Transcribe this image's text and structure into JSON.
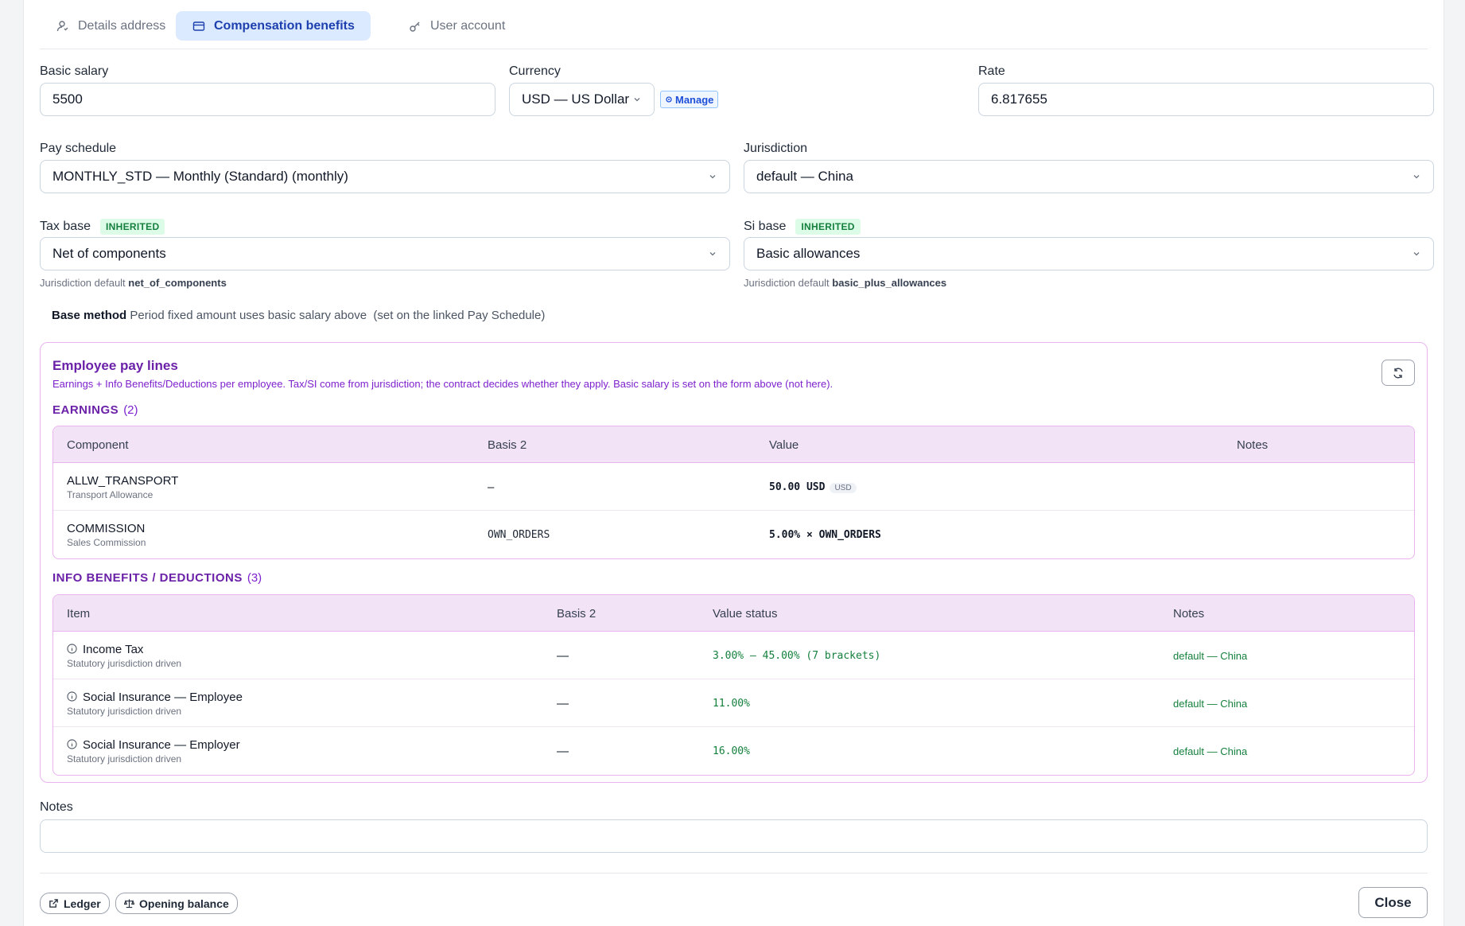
{
  "tabs": [
    {
      "label": "Details address",
      "icon": "user-icon"
    },
    {
      "label": "Compensation benefits",
      "icon": "card-icon"
    },
    {
      "label": "User account",
      "icon": "key-icon"
    }
  ],
  "form": {
    "basic_salary_label": "Basic salary",
    "basic_salary_value": "5500",
    "currency_label": "Currency",
    "currency_value": "USD — US Dollar",
    "manage_label": "Manage",
    "rate_label": "Rate",
    "rate_value": "6.817655",
    "pay_schedule_label": "Pay schedule",
    "pay_schedule_value": "MONTHLY_STD — Monthly (Standard) (monthly)",
    "jurisdiction_label": "Jurisdiction",
    "jurisdiction_value": "default — China",
    "tax_base_label": "Tax base",
    "tax_base_badge": "INHERITED",
    "tax_base_value": "Net of components",
    "tax_base_hint_prefix": "Jurisdiction default",
    "tax_base_hint_value": "net_of_components",
    "si_base_label": "Si base",
    "si_base_badge": "INHERITED",
    "si_base_value": "Basic allowances",
    "si_base_hint_prefix": "Jurisdiction default",
    "si_base_hint_value": "basic_plus_allowances",
    "base_method_label": "Base method",
    "base_method_text": "Period fixed amount uses basic salary above",
    "base_method_note": "(set on the linked Pay Schedule)"
  },
  "pay_lines": {
    "title": "Employee pay lines",
    "subtitle": "Earnings + Info Benefits/Deductions per employee. Tax/SI come from jurisdiction; the contract decides whether they apply. Basic salary is set on the form above (not here).",
    "earnings": {
      "title": "EARNINGS",
      "count": "(2)",
      "headers": [
        "Component",
        "Basis 2",
        "Value",
        "Notes"
      ],
      "rows": [
        {
          "code": "ALLW_TRANSPORT",
          "name": "Transport Allowance",
          "basis": "–",
          "value": "50.00 USD",
          "currency_tag": "USD",
          "notes": ""
        },
        {
          "code": "COMMISSION",
          "name": "Sales Commission",
          "basis": "OWN_ORDERS",
          "value": "5.00% × OWN_ORDERS",
          "currency_tag": "",
          "notes": ""
        }
      ]
    },
    "info": {
      "title": "INFO BENEFITS / DEDUCTIONS",
      "count": "(3)",
      "headers": [
        "Item",
        "Basis 2",
        "Value status",
        "Notes"
      ],
      "rows": [
        {
          "name": "Income Tax",
          "sub": "Statutory jurisdiction driven",
          "basis": "—",
          "value": "3.00% – 45.00% (7 brackets)",
          "notes": "default — China"
        },
        {
          "name": "Social Insurance — Employee",
          "sub": "Statutory jurisdiction driven",
          "basis": "—",
          "value": "11.00%",
          "notes": "default — China"
        },
        {
          "name": "Social Insurance — Employer",
          "sub": "Statutory jurisdiction driven",
          "basis": "—",
          "value": "16.00%",
          "notes": "default — China"
        }
      ]
    }
  },
  "notes_label": "Notes",
  "footer": {
    "ledger_label": "Ledger",
    "opening_balance_label": "Opening balance",
    "close_label": "Close"
  }
}
